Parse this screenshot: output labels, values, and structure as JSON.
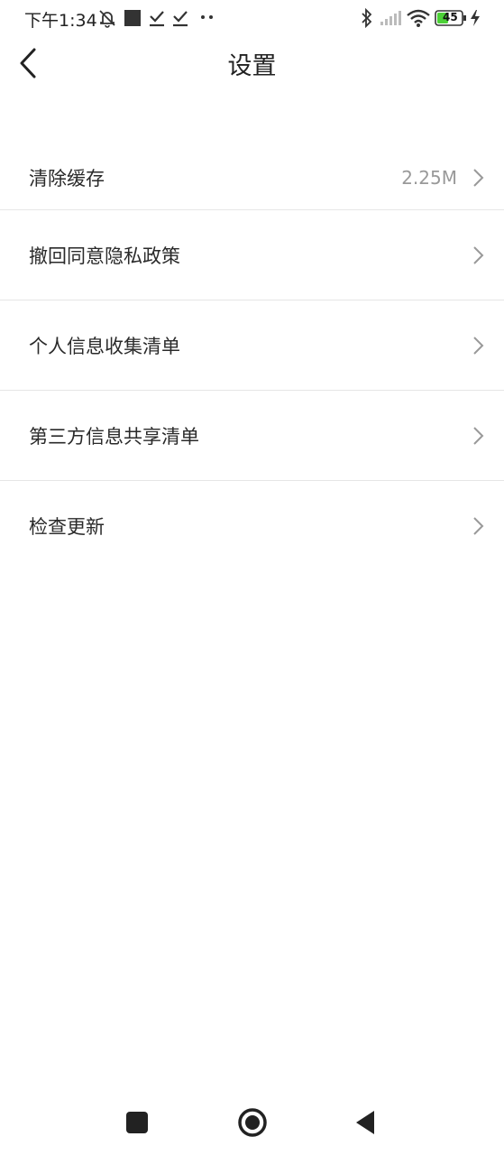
{
  "status_bar": {
    "time": "下午1:34",
    "battery": "45"
  },
  "header": {
    "title": "设置"
  },
  "settings": {
    "items": [
      {
        "label": "清除缓存",
        "value": "2.25M"
      },
      {
        "label": "撤回同意隐私政策"
      },
      {
        "label": "个人信息收集清单"
      },
      {
        "label": "第三方信息共享清单"
      },
      {
        "label": "检查更新"
      }
    ]
  },
  "icons": {
    "back": "back-arrow-icon",
    "chevron": "chevron-right-icon",
    "nav": [
      "recent-apps-icon",
      "home-icon",
      "back-triangle-icon"
    ]
  },
  "colors": {
    "text": "#222222",
    "secondary": "#999999",
    "divider": "#e6e6e6",
    "battery_fill": "#4cd137"
  }
}
